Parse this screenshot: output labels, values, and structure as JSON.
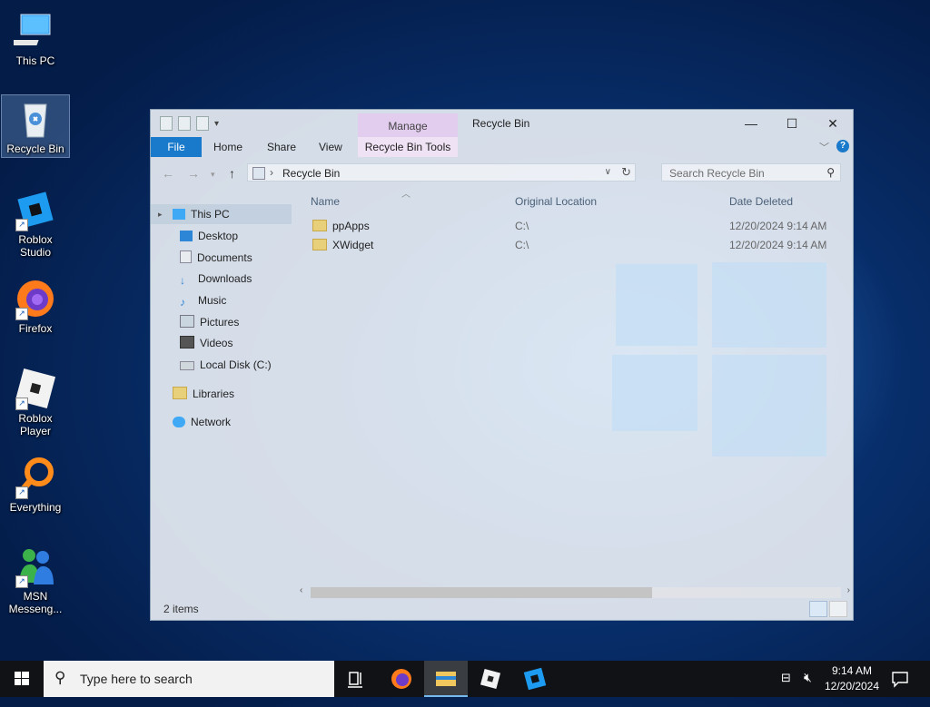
{
  "desktop": {
    "icons": [
      {
        "label": "This PC"
      },
      {
        "label": "Recycle Bin"
      },
      {
        "label": "Roblox Studio"
      },
      {
        "label": "Firefox"
      },
      {
        "label": "Roblox Player"
      },
      {
        "label": "Everything"
      },
      {
        "label": "MSN Messeng..."
      }
    ]
  },
  "explorer": {
    "title": "Recycle Bin",
    "manage_tab": "Manage",
    "ribbon_tabs": [
      "File",
      "Home",
      "Share",
      "View",
      "Recycle Bin Tools"
    ],
    "address": "Recycle Bin",
    "search_placeholder": "Search Recycle Bin",
    "nav": {
      "this_pc": "This PC",
      "items": [
        "Desktop",
        "Documents",
        "Downloads",
        "Music",
        "Pictures",
        "Videos",
        "Local Disk (C:)"
      ],
      "libraries": "Libraries",
      "network": "Network"
    },
    "columns": [
      "Name",
      "Original Location",
      "Date Deleted"
    ],
    "rows": [
      {
        "name": "ppApps",
        "location": "C:\\",
        "date": "12/20/2024 9:14 AM"
      },
      {
        "name": "XWidget",
        "location": "C:\\",
        "date": "12/20/2024 9:14 AM"
      }
    ],
    "status": "2 items"
  },
  "taskbar": {
    "search_placeholder": "Type here to search",
    "time": "9:14 AM",
    "date": "12/20/2024"
  },
  "colors": {
    "accent": "#1979ca",
    "manage_tab": "#e2cdee",
    "taskbar": "#101216",
    "desktop_bg": "#083170"
  }
}
